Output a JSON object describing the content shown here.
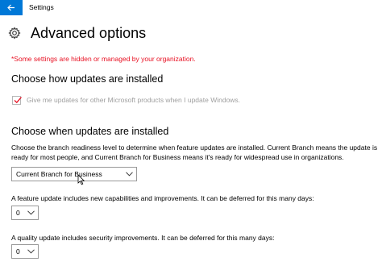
{
  "titlebar": {
    "back_icon": "back-arrow-icon",
    "title": "Settings",
    "accent_color": "#0078d7"
  },
  "header": {
    "icon": "gear-icon",
    "title": "Advanced options"
  },
  "org_warning": {
    "text": "*Some settings are hidden or managed by your organization.",
    "color": "#e81123"
  },
  "install_section": {
    "heading": "Choose how updates are installed",
    "checkbox": {
      "label": "Give me updates for other Microsoft products when I update Windows.",
      "checked": true,
      "disabled": true
    }
  },
  "when_section": {
    "heading": "Choose when updates are installed",
    "description": "Choose the branch readiness level to determine when feature updates are installed. Current Branch means the update is ready for most people, and Current Branch for Business means it's ready for widespread use in organizations.",
    "branch_select": {
      "value": "Current Branch for Business"
    },
    "feature_label": "A feature update includes new capabilities and improvements. It can be deferred for this many days:",
    "feature_select": {
      "value": "0"
    },
    "quality_label": "A quality update includes security improvements. It can be deferred for this many days:",
    "quality_select": {
      "value": "0"
    }
  }
}
